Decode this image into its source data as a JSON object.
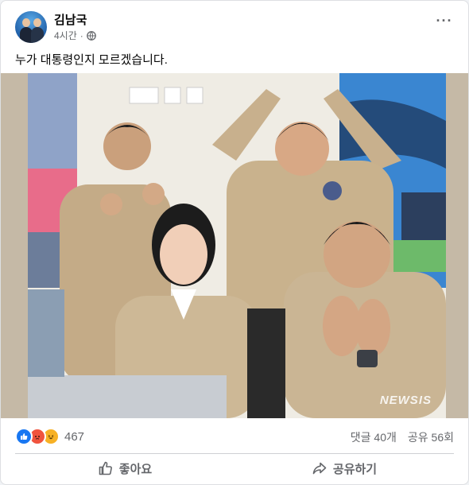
{
  "post": {
    "author": "김남국",
    "time": "4시간",
    "separator": "·",
    "privacy_icon": "globe-icon",
    "more_icon": "more-options-icon",
    "text": "누가 대통령인지 모르겠습니다.",
    "photo": {
      "watermark": "NEWSIS"
    }
  },
  "reactions": {
    "icons": [
      "like-reaction-icon",
      "angry-reaction-icon",
      "haha-reaction-icon"
    ],
    "count": "467",
    "comments": "댓글 40개",
    "shares": "공유 56회"
  },
  "actions": {
    "like_label": "좋아요",
    "share_label": "공유하기"
  },
  "colors": {
    "facebook_blue": "#1877f2",
    "angry_orange": "#f0533e",
    "haha_yellow": "#f7b125",
    "secondary_text": "#65676b"
  }
}
